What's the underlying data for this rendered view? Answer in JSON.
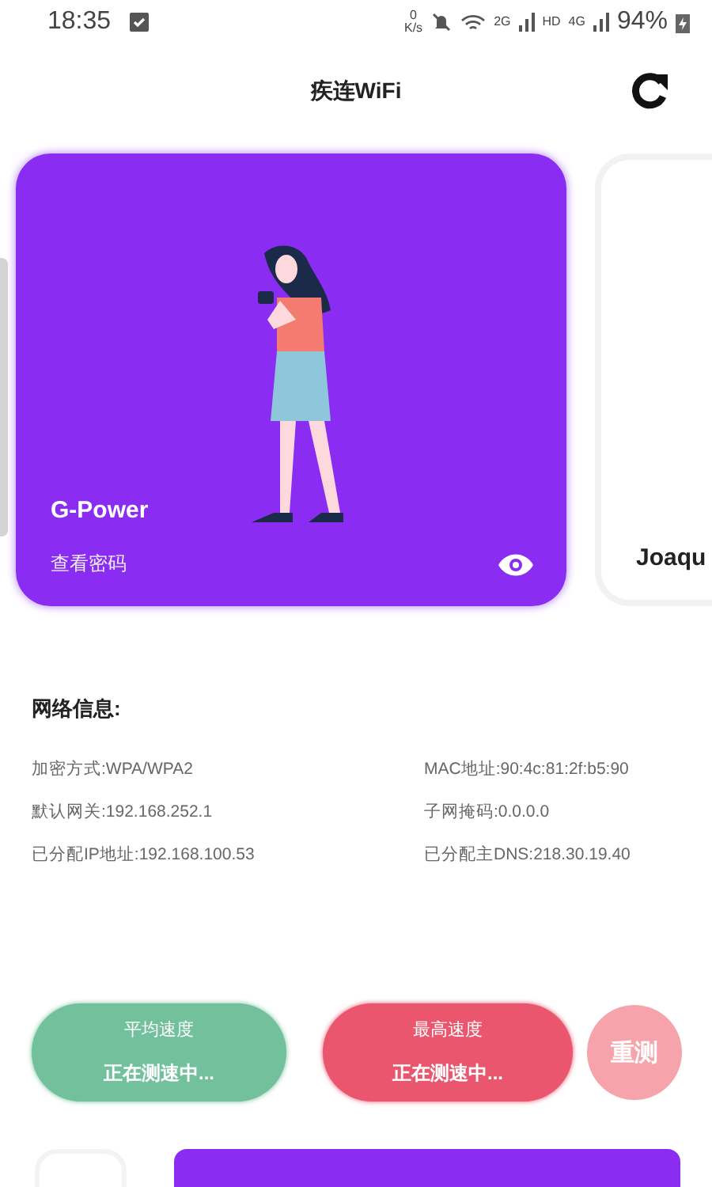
{
  "status_bar": {
    "time": "18:35",
    "speed_value": "0",
    "speed_unit": "K/s",
    "sim1": "2G",
    "hd": "HD",
    "sim2": "4G",
    "battery": "94%"
  },
  "header": {
    "title": "疾连WiFi"
  },
  "networks": [
    {
      "name": "G-Power",
      "action": "查看密码",
      "selected": true
    },
    {
      "name": "Joaqu",
      "selected": false
    }
  ],
  "network_info": {
    "title": "网络信息:",
    "rows": [
      [
        "加密方式:WPA/WPA2",
        "MAC地址:90:4c:81:2f:b5:90"
      ],
      [
        "默认网关:192.168.252.1",
        "子网掩码:0.0.0.0"
      ],
      [
        "已分配IP地址:192.168.100.53",
        "已分配主DNS:218.30.19.40"
      ]
    ]
  },
  "speed": [
    {
      "kind": "average",
      "label": "平均速度",
      "value": "正在测速中..."
    },
    {
      "kind": "max",
      "label": "最高速度",
      "value": "正在测速中..."
    }
  ],
  "retest": "重测"
}
